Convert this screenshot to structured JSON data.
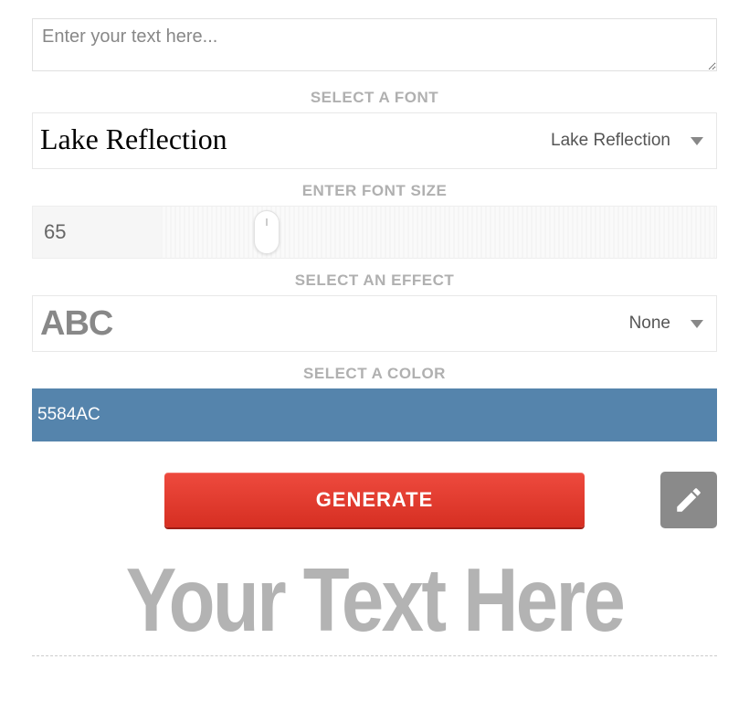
{
  "text_input": {
    "placeholder": "Enter your text here...",
    "value": ""
  },
  "labels": {
    "select_font": "SELECT A FONT",
    "enter_font_size": "ENTER FONT SIZE",
    "select_effect": "SELECT AN EFFECT",
    "select_color": "SELECT A COLOR"
  },
  "font": {
    "selected": "Lake Reflection",
    "preview_text": "Lake Reflection"
  },
  "font_size": {
    "value": "65"
  },
  "effect": {
    "selected": "None",
    "preview_text": "ABC"
  },
  "color": {
    "hex": "5584AC",
    "css": "#5584AC"
  },
  "buttons": {
    "generate": "GENERATE"
  },
  "output": {
    "sample_text": "Your Text Here"
  }
}
